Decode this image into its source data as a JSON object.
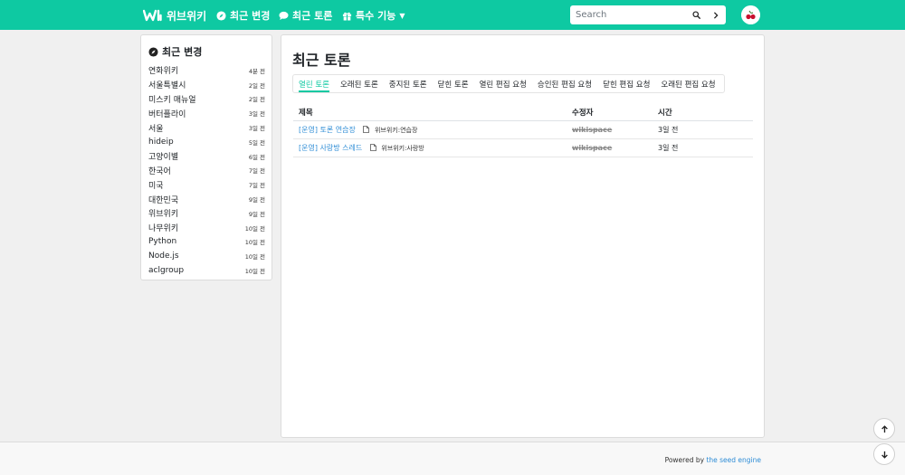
{
  "app": {
    "name": "위브위키"
  },
  "nav": {
    "recent_changes": "최근 변경",
    "recent_discussions": "최근 토론",
    "special_features": "특수 기능"
  },
  "search": {
    "placeholder": "Search"
  },
  "sidebar": {
    "title": "최근 변경",
    "items": [
      {
        "doc": "연화위키",
        "time": "4분 전"
      },
      {
        "doc": "서울특별시",
        "time": "2일 전"
      },
      {
        "doc": "미스키 매뉴얼",
        "time": "2일 전"
      },
      {
        "doc": "버터플라이",
        "time": "3일 전"
      },
      {
        "doc": "서울",
        "time": "3일 전"
      },
      {
        "doc": "hideip",
        "time": "5일 전"
      },
      {
        "doc": "고양이별",
        "time": "6일 전"
      },
      {
        "doc": "한국어",
        "time": "7일 전"
      },
      {
        "doc": "미국",
        "time": "7일 전"
      },
      {
        "doc": "대한민국",
        "time": "9일 전"
      },
      {
        "doc": "위브위키",
        "time": "9일 전"
      },
      {
        "doc": "나무위키",
        "time": "10일 전"
      },
      {
        "doc": "Python",
        "time": "10일 전"
      },
      {
        "doc": "Node.js",
        "time": "10일 전"
      },
      {
        "doc": "aclgroup",
        "time": "10일 전"
      }
    ]
  },
  "main": {
    "title": "최근 토론",
    "tabs": [
      {
        "label": "열린 토론",
        "active": true
      },
      {
        "label": "오래된 토론"
      },
      {
        "label": "중지된 토론"
      },
      {
        "label": "닫힌 토론"
      },
      {
        "label": "열린 편집 요청"
      },
      {
        "label": "승인된 편집 요청"
      },
      {
        "label": "닫힌 편집 요청"
      },
      {
        "label": "오래된 편집 요청"
      }
    ],
    "table": {
      "headers": {
        "title": "제목",
        "editor": "수정자",
        "time": "시간"
      },
      "rows": [
        {
          "topic": "[운영] 토론 연습장",
          "doc": "위브위키:연습장",
          "editor": "wikispace",
          "time": "3일 전"
        },
        {
          "topic": "[운영] 사랑방 스레드",
          "doc": "위브위키:사랑방",
          "editor": "wikispace",
          "time": "3일 전"
        }
      ]
    }
  },
  "footer": {
    "powered_prefix": "Powered by",
    "engine_link": "the seed engine"
  },
  "colors": {
    "brand": "#0ec9a2",
    "link": "#2f8dd6"
  }
}
